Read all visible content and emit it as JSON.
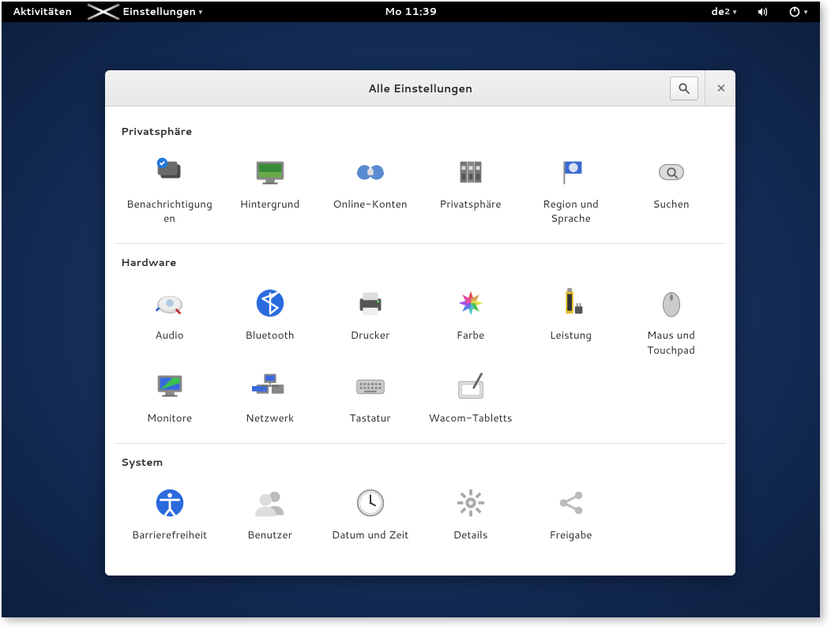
{
  "topbar": {
    "activities": "Aktivitäten",
    "app_menu": "Einstellungen",
    "clock": "Mo 11:39",
    "keyboard_layout": "de",
    "keyboard_layout_index": "2"
  },
  "window": {
    "title": "Alle Einstellungen"
  },
  "sections": {
    "personal": {
      "title": "Privatsphäre",
      "items": [
        {
          "label": "Benachrichtigungen",
          "icon": "notifications-icon"
        },
        {
          "label": "Hintergrund",
          "icon": "wallpaper-icon"
        },
        {
          "label": "Online-Konten",
          "icon": "online-accounts-icon"
        },
        {
          "label": "Privatsphäre",
          "icon": "privacy-icon"
        },
        {
          "label": "Region und Sprache",
          "icon": "region-language-icon"
        },
        {
          "label": "Suchen",
          "icon": "search-settings-icon"
        }
      ]
    },
    "hardware": {
      "title": "Hardware",
      "items": [
        {
          "label": "Audio",
          "icon": "audio-icon"
        },
        {
          "label": "Bluetooth",
          "icon": "bluetooth-icon"
        },
        {
          "label": "Drucker",
          "icon": "printer-icon"
        },
        {
          "label": "Farbe",
          "icon": "color-icon"
        },
        {
          "label": "Leistung",
          "icon": "power-icon"
        },
        {
          "label": "Maus und Touchpad",
          "icon": "mouse-icon"
        },
        {
          "label": "Monitore",
          "icon": "displays-icon"
        },
        {
          "label": "Netzwerk",
          "icon": "network-icon"
        },
        {
          "label": "Tastatur",
          "icon": "keyboard-icon"
        },
        {
          "label": "Wacom-Tabletts",
          "icon": "wacom-icon"
        }
      ]
    },
    "system": {
      "title": "System",
      "items": [
        {
          "label": "Barrierefreiheit",
          "icon": "accessibility-icon"
        },
        {
          "label": "Benutzer",
          "icon": "users-icon"
        },
        {
          "label": "Datum und Zeit",
          "icon": "datetime-icon"
        },
        {
          "label": "Details",
          "icon": "details-icon"
        },
        {
          "label": "Freigabe",
          "icon": "sharing-icon"
        }
      ]
    }
  }
}
